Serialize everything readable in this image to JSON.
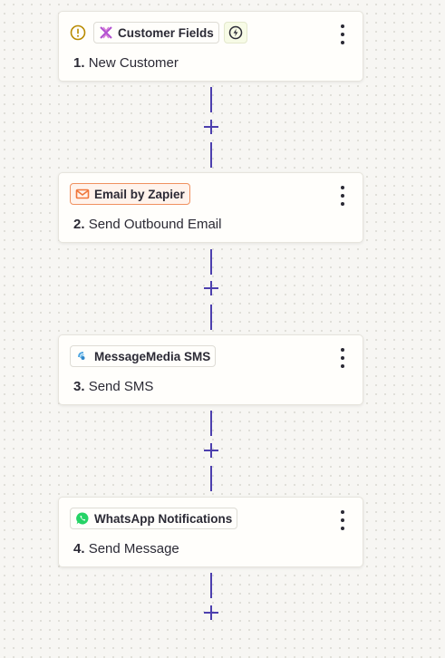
{
  "steps": [
    {
      "app": "Customer Fields",
      "number": "1.",
      "action": "New Customer",
      "warning_icon": "alert-circle-icon",
      "app_icon": "customer-fields-icon",
      "trigger_icon": "lightning-bolt-icon"
    },
    {
      "app": "Email by Zapier",
      "number": "2.",
      "action": "Send Outbound Email",
      "app_icon": "email-icon"
    },
    {
      "app": "MessageMedia SMS",
      "number": "3.",
      "action": "Send SMS",
      "app_icon": "messagemedia-icon"
    },
    {
      "app": "WhatsApp Notifications",
      "number": "4.",
      "action": "Send Message",
      "app_icon": "whatsapp-icon"
    }
  ],
  "colors": {
    "connector": "#4c3fae",
    "email_accent": "#f0915f",
    "warning": "#b88a00",
    "whatsapp": "#25d366"
  }
}
